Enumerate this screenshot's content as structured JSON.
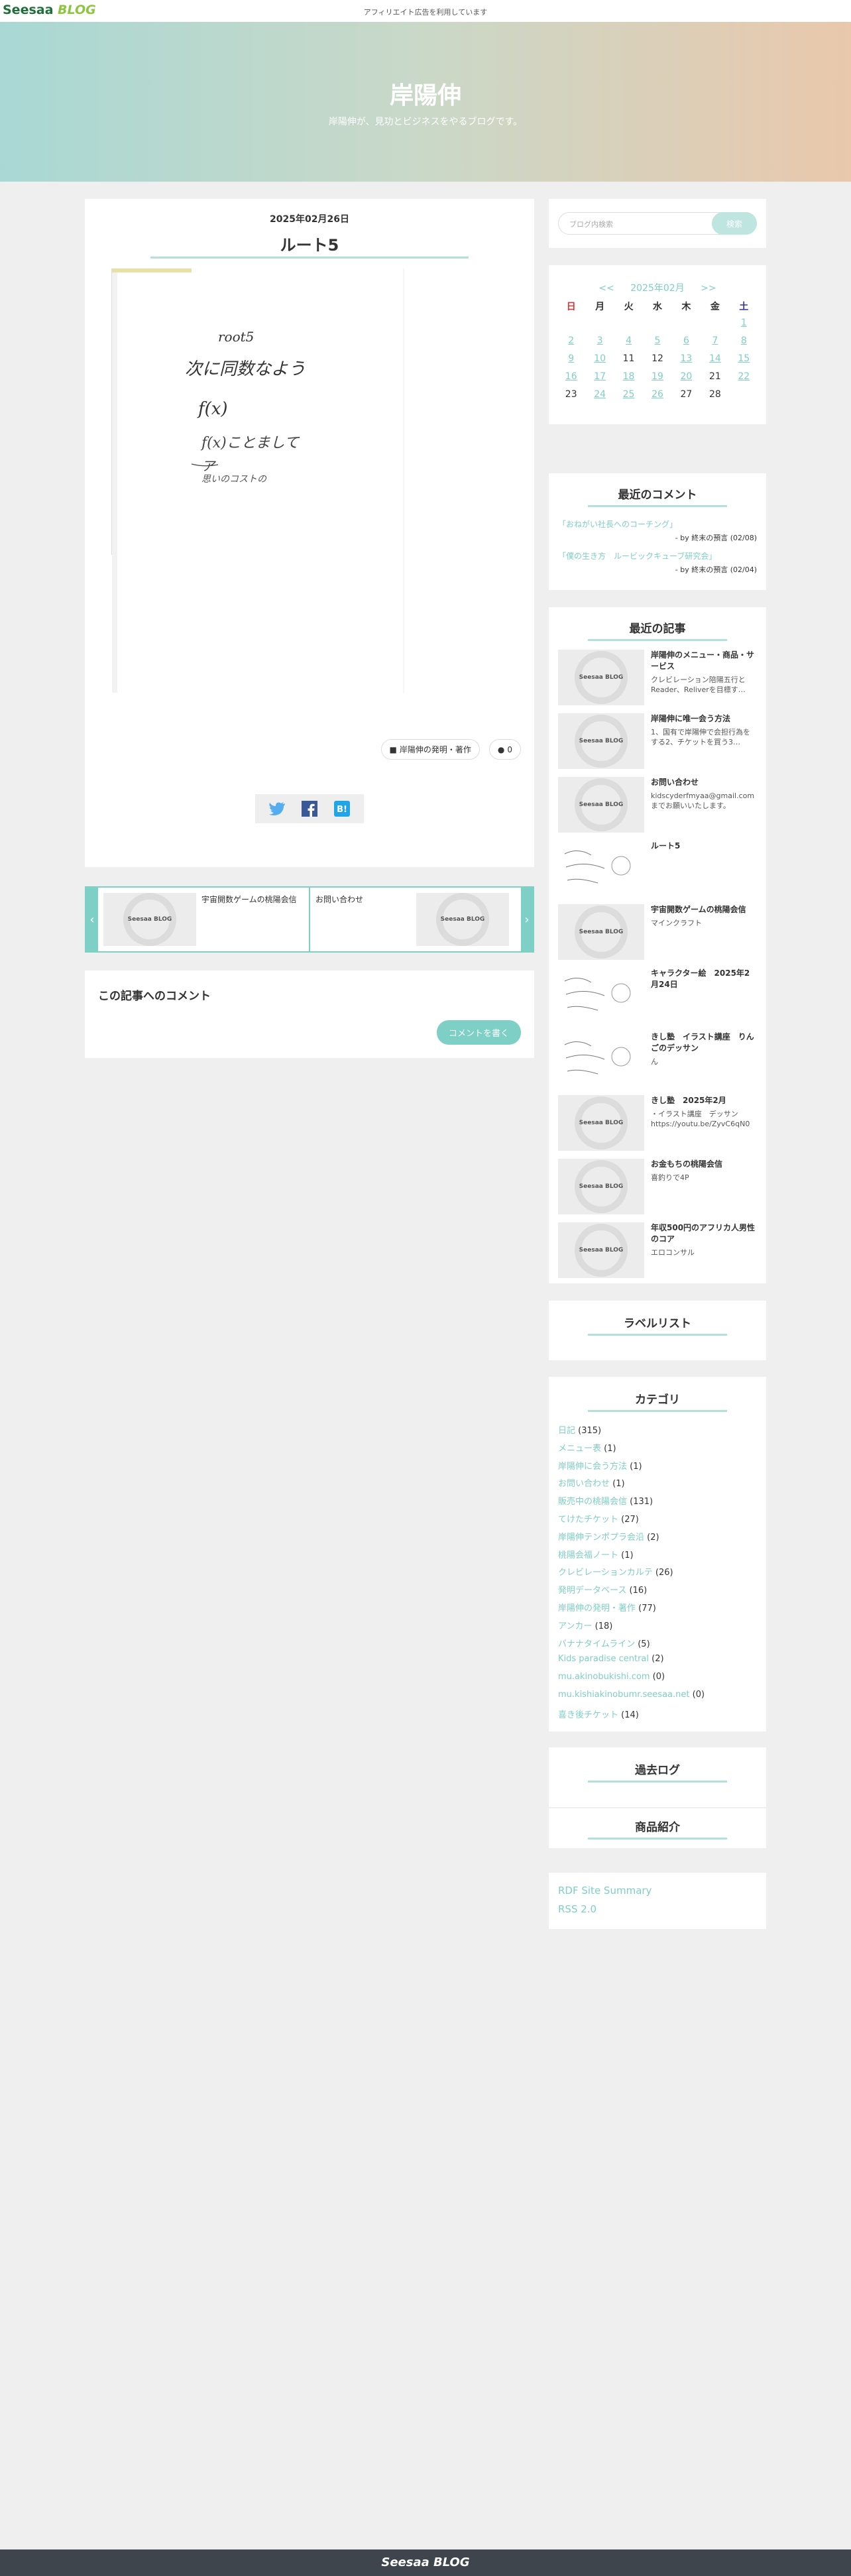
{
  "header": {
    "logo_seesaa": "Seesaa",
    "logo_blog": "BLOG",
    "notice": "アフィリエイト広告を利用しています"
  },
  "hero": {
    "title": "岸陽伸",
    "subtitle": "岸陽伸が、見功とビジネスをやるブログです。"
  },
  "article": {
    "date": "2025年02月26日",
    "title": "ルート5",
    "handwriting": {
      "line1": "root5",
      "line2": "次に同数なよう",
      "line3": "f(x)",
      "line4": "f(x)ことまして",
      "line5": "ア",
      "line6": "思いのコストの"
    },
    "category_tag": "岸陽伸の発明・著作",
    "comment_count": "0",
    "share_icons": [
      "twitter-icon",
      "facebook-icon",
      "hatena-bookmark-icon"
    ]
  },
  "related": {
    "prev_arrow": "‹",
    "next_arrow": "›",
    "items": [
      {
        "title": "宇宙開数ゲームの桃陽会信",
        "thumb": "Seesaa BLOG"
      },
      {
        "title": "お問い合わせ",
        "thumb": "Seesaa BLOG"
      }
    ]
  },
  "comments": {
    "heading": "この記事へのコメント",
    "button": "コメントを書く"
  },
  "sidebar": {
    "search": {
      "placeholder": "ブログ内検索",
      "button": "検索"
    },
    "calendar": {
      "prev": "<<",
      "month": "2025年02月",
      "next": ">>",
      "weekdays": [
        "日",
        "月",
        "火",
        "水",
        "木",
        "金",
        "土"
      ],
      "days": [
        [
          "",
          "",
          "",
          "",
          "",
          "",
          "1"
        ],
        [
          "2",
          "3",
          "4",
          "5",
          "6",
          "7",
          "8"
        ],
        [
          "9",
          "10",
          "11",
          "12",
          "13",
          "14",
          "15"
        ],
        [
          "16",
          "17",
          "18",
          "19",
          "20",
          "21",
          "22"
        ],
        [
          "23",
          "24",
          "25",
          "26",
          "27",
          "28",
          ""
        ]
      ],
      "linked_days": [
        "1",
        "2",
        "3",
        "4",
        "5",
        "6",
        "7",
        "8",
        "9",
        "10",
        "13",
        "14",
        "15",
        "16",
        "17",
        "18",
        "19",
        "20",
        "22",
        "24",
        "25",
        "26"
      ]
    },
    "recent_comments": {
      "heading": "最近のコメント",
      "items": [
        {
          "link": "「おねがい社長へのコーチング」",
          "by": "- by 終末の預言 (02/08)"
        },
        {
          "link": "「僕の生き方　ルービックキューブ研究会」",
          "by": "- by 終末の預言 (02/04)"
        }
      ]
    },
    "recent_posts": {
      "heading": "最近の記事",
      "items": [
        {
          "title": "岸陽伸のメニュー・商品・サービス",
          "excerpt": "クレビレーション陪陽五行とReader、Reliverを目標す…",
          "thumb": "Seesaa BLOG"
        },
        {
          "title": "岸陽伸に唯一会う方法",
          "excerpt": "1、国有で岸陽伸で会担行為をする2、チケットを買う3…",
          "thumb": "Seesaa BLOG"
        },
        {
          "title": "お問い合わせ",
          "excerpt": "kidscyderfmyaa@gmail.comまでお願いいたします。",
          "thumb": "Seesaa BLOG"
        },
        {
          "title": "ルート5",
          "excerpt": "",
          "thumb": ""
        },
        {
          "title": "宇宙開数ゲームの桃陽会信",
          "excerpt": "マインクラフト",
          "thumb": "Seesaa BLOG"
        },
        {
          "title": "キャラクター絵　2025年2月24日",
          "excerpt": "",
          "thumb": ""
        },
        {
          "title": "きし塾　イラスト講座　りんごのデッサン",
          "excerpt": "ん",
          "thumb": ""
        },
        {
          "title": "きし塾　2025年2月",
          "excerpt": "・イラスト講座　デッサンhttps://youtu.be/ZyvC6qN0",
          "thumb": "Seesaa BLOG"
        },
        {
          "title": "お金もちの桃陽会信",
          "excerpt": "喜釣りで4P",
          "thumb": "Seesaa BLOG"
        },
        {
          "title": "年収500円のアフリカ人男性のコア",
          "excerpt": "エロコンサル",
          "thumb": "Seesaa BLOG"
        }
      ]
    },
    "label_list": {
      "heading": "ラベルリスト"
    },
    "categories": {
      "heading": "カテゴリ",
      "items": [
        {
          "name": "日記",
          "count": "(315)"
        },
        {
          "name": "メニュー表",
          "count": "(1)"
        },
        {
          "name": "岸陽伸に会う方法",
          "count": "(1)"
        },
        {
          "name": "お問い合わせ",
          "count": "(1)"
        },
        {
          "name": "販売中の桃陽会信",
          "count": "(131)"
        },
        {
          "name": "てけたチケット",
          "count": "(27)"
        },
        {
          "name": "岸陽伸テンポプラ会沿",
          "count": "(2)"
        },
        {
          "name": "桃陽会福ノート",
          "count": "(1)"
        },
        {
          "name": "クレビレーションカルテ",
          "count": "(26)"
        },
        {
          "name": "発明データベース",
          "count": "(16)"
        },
        {
          "name": "岸陽伸の発明・著作",
          "count": "(77)"
        },
        {
          "name": "アンカー",
          "count": "(18)"
        },
        {
          "name": "バナナタイムライン",
          "count": "(5)"
        },
        {
          "name": "Kids paradise central",
          "count": "(2)"
        },
        {
          "name": "mu.akinobukishi.com",
          "count": "(0)"
        },
        {
          "name": "mu.kishiakinobumr.seesaa.net",
          "count": "(0)"
        },
        {
          "name": "喜き後チケット",
          "count": "(14)"
        }
      ]
    },
    "archive": {
      "heading": "過去ログ",
      "products_heading": "商品紹介"
    },
    "feeds": {
      "rdf": "RDF Site Summary",
      "rss": "RSS 2.0"
    }
  },
  "footer": {
    "logo": "Seesaa BLOG"
  }
}
